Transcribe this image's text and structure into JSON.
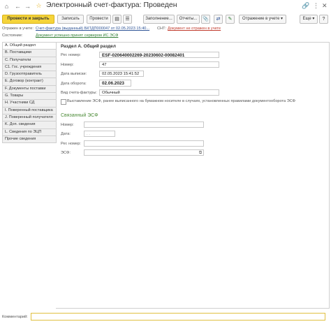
{
  "window": {
    "title": "Электронный счет-фактура: Проведен",
    "more_dots": "⋮",
    "close": "✕",
    "link_icon": "link-icon",
    "star_icon": "star-icon"
  },
  "toolbar": {
    "post_close": "Провести и закрыть",
    "save": "Записать",
    "post": "Провести",
    "fill": "Заполнение...",
    "reports": "Отчеты...",
    "esf_display": "Отражение в учете",
    "more": "Еще"
  },
  "header": {
    "reflected_label": "Отражен в учете:",
    "reflected_link": "Счет-фактура (выданный) БКТДП000047 от 02.05.2023 15:40...",
    "snt_label": "СНТ:",
    "snt_link": "Документ не отражен в учете",
    "state_label": "Состояние:",
    "state_link": "Документ успешно принят сервером ИС ЭСФ"
  },
  "tabs": [
    "A. Общий раздел",
    "B. Поставщики",
    "C. Получатели",
    "C1. Гос. учреждения",
    "D. Грузоотправитель",
    "E. Договор (контракт)",
    "F. Документы поставки",
    "G. Товары",
    "H. Участники СД",
    "I. Поверенный поставщика",
    "J. Поверенный получателя",
    "K. Доп. сведения",
    "L. Сведения по ЭЦП",
    "Прочие сведения"
  ],
  "section_a": {
    "title": "Раздел A. Общий раздел",
    "reg_number_label": "Рег. номер:",
    "reg_number_value": "ESF-020640002269-20230602-00082401",
    "number_label": "Номер:",
    "number_value": "47",
    "issue_date_label": "Дата выписки:",
    "issue_date_value": "02.05.2023 15:41:52",
    "turnover_date_label": "Дата оборота:",
    "turnover_date_value": "02.06.2023",
    "type_label": "Вид счета-фактуры:",
    "type_value": "Обычный",
    "paper_checkbox_label": "Выставление ЭСФ, ранее выписанного на бумажном носителе в случаях, установленных правилами документооборота ЭСФ"
  },
  "related": {
    "title": "Связанный ЭСФ",
    "number_label": "Номер:",
    "date_label": "Дата:",
    "date_placeholder": ". .",
    "reg_number_label": "Рег. номер:",
    "esf_label": "ЭСФ:"
  },
  "footer": {
    "comment_label": "Комментарий:"
  }
}
